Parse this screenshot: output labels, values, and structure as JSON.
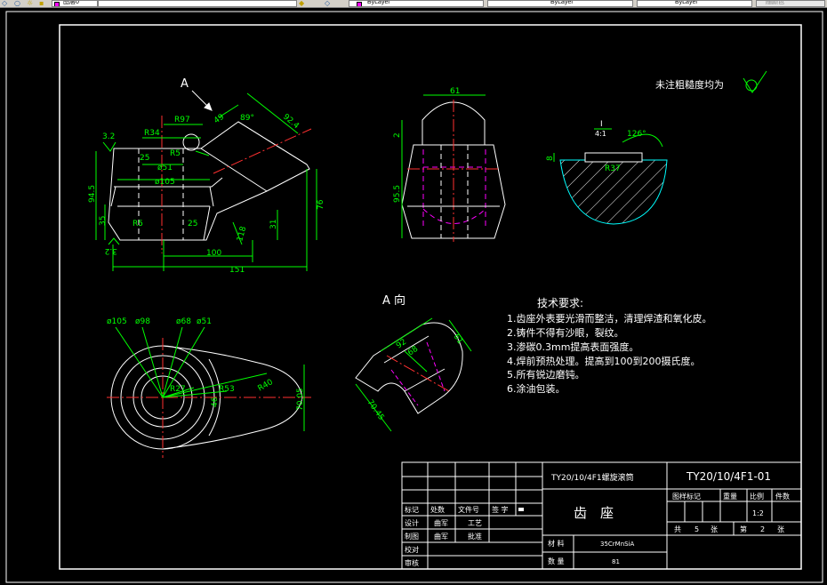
{
  "toolbar": {
    "layer_name": "图层0",
    "color_value": "ByLayer",
    "linetype_value": "ByLayer",
    "lineweight_value": "ByLayer",
    "plotstyle_value": "随颜色"
  },
  "colors": {
    "background": "#000000",
    "outline": "#ffffff",
    "dimension": "#00ff00",
    "centerline": "#ff3030",
    "hidden": "#ff00ff",
    "section": "#00ffff",
    "hatch": "#ffffff",
    "frame": "#ffffff"
  },
  "views": {
    "front": {
      "view_label": "A",
      "dims": {
        "r97": "R97",
        "r34": "R34",
        "r5_top": "R5",
        "d51": "ø51",
        "d105": "ø105",
        "h94_5": "94.5",
        "h35": "35",
        "r5_low": "R5",
        "d25_top": "25",
        "d25_low": "25",
        "a49": "49",
        "a89": "89°",
        "d92_4": "92.4",
        "h76": "76",
        "h31": "31",
        "d118": "118",
        "w100": "100",
        "w151": "151",
        "rough_top": "3.2",
        "rough_bottom": "3.2"
      }
    },
    "side": {
      "dims": {
        "w61": "61",
        "h2": "2",
        "h95_5": "95.5"
      }
    },
    "detail": {
      "scale_label": "I",
      "scale_ratio": "4:1",
      "dims": {
        "r37": "R37",
        "a126": "126°",
        "h8": "8"
      }
    },
    "top": {
      "dims": {
        "d105": "ø105",
        "d98": "ø98",
        "d68": "ø68",
        "d51": "ø51",
        "r27": "R27",
        "r53": "R53",
        "r40": "R40",
        "h7005": "70.05",
        "h46": "46"
      }
    },
    "aux": {
      "view_label": "A 向",
      "dims": {
        "d61": "61",
        "d92": "92",
        "d68": "68",
        "d7045": "70.45"
      }
    }
  },
  "roughness_note": "未注粗糙度均为",
  "tech": {
    "title": "技术要求:",
    "items": [
      "1.齿座外表要光滑而整洁，清理焊渣和氧化皮。",
      "2.铸件不得有沙眼，裂纹。",
      "3.渗碳0.3mm提高表面强度。",
      "4.焊前预热处理。提高到100到200摄氏度。",
      "5.所有锐边磨钝。",
      "6.涂油包装。"
    ]
  },
  "title_block": {
    "project": "TY20/10/4F1螺旋滚筒",
    "drawing_no": "TY20/10/4F1-01",
    "part_name": "齿　座",
    "labels": {
      "mark": "标记",
      "zone": "处数",
      "doc_no": "文件号",
      "sign": "签 字",
      "design": "设计",
      "draw": "制图",
      "check": "校对",
      "review": "审核",
      "process": "工艺",
      "approve": "批准",
      "material_label": "材 料",
      "qty_label": "数 量",
      "stage_mark": "图样标记",
      "weight": "重量",
      "scale": "比例",
      "pieces": "件数",
      "total": "共",
      "sheets": "张",
      "sheet_no": "第",
      "sheet_unit": "张"
    },
    "design_name": "曲军",
    "draw_name": "曲军",
    "material": "35CrMnSiA",
    "quantity": "81",
    "scale_value": "1:2",
    "total_sheets": "5",
    "sheet_index": "2"
  }
}
